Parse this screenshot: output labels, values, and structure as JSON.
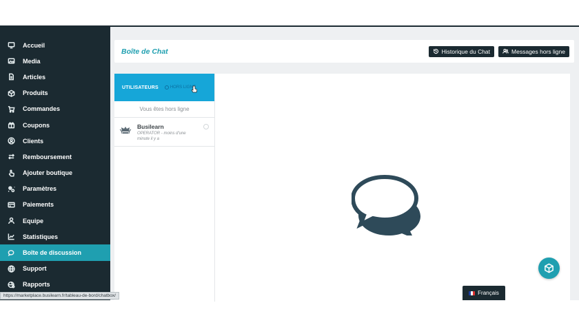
{
  "sidebar": {
    "items": [
      {
        "label": "Accueil",
        "icon": "monitor-icon"
      },
      {
        "label": "Media",
        "icon": "image-icon"
      },
      {
        "label": "Articles",
        "icon": "document-icon"
      },
      {
        "label": "Produits",
        "icon": "box-icon"
      },
      {
        "label": "Commandes",
        "icon": "cart-icon"
      },
      {
        "label": "Coupons",
        "icon": "gift-icon"
      },
      {
        "label": "Clients",
        "icon": "user-circle-icon"
      },
      {
        "label": "Remboursement",
        "icon": "refund-arrows-icon"
      },
      {
        "label": "Ajouter boutique",
        "icon": "hand-pointer-icon"
      },
      {
        "label": "Paramètres",
        "icon": "gears-icon"
      },
      {
        "label": "Paiements",
        "icon": "credit-card-icon"
      },
      {
        "label": "Equipe",
        "icon": "user-icon"
      },
      {
        "label": "Statistiques",
        "icon": "line-chart-icon"
      },
      {
        "label": "Boîte de discussion",
        "icon": "chat-icon",
        "active": true
      },
      {
        "label": "Support",
        "icon": "globe-icon"
      },
      {
        "label": "Rapports",
        "icon": "globe-gear-icon"
      }
    ]
  },
  "header": {
    "title": "Boîte de Chat",
    "history_button": "Historique du Chat",
    "offline_messages_button": "Messages hors ligne"
  },
  "users_panel": {
    "tab_users": "UTILISATEURS",
    "tab_offline": "HORS LIGNE",
    "status_message": "Vous êtes hors ligne",
    "users": [
      {
        "name": "Busilearn",
        "meta": "OPERATOR - moins d'une minute il y a"
      }
    ]
  },
  "language": {
    "label": "Français"
  },
  "status_url": "https://marketplace.busilearn.fr/tableau-de-bord/chatbox/",
  "colors": {
    "sidebar_bg": "#1b2a31",
    "accent": "#1f9fb0",
    "users_header": "#16a6d8",
    "chat_icon": "#2e4a59"
  }
}
